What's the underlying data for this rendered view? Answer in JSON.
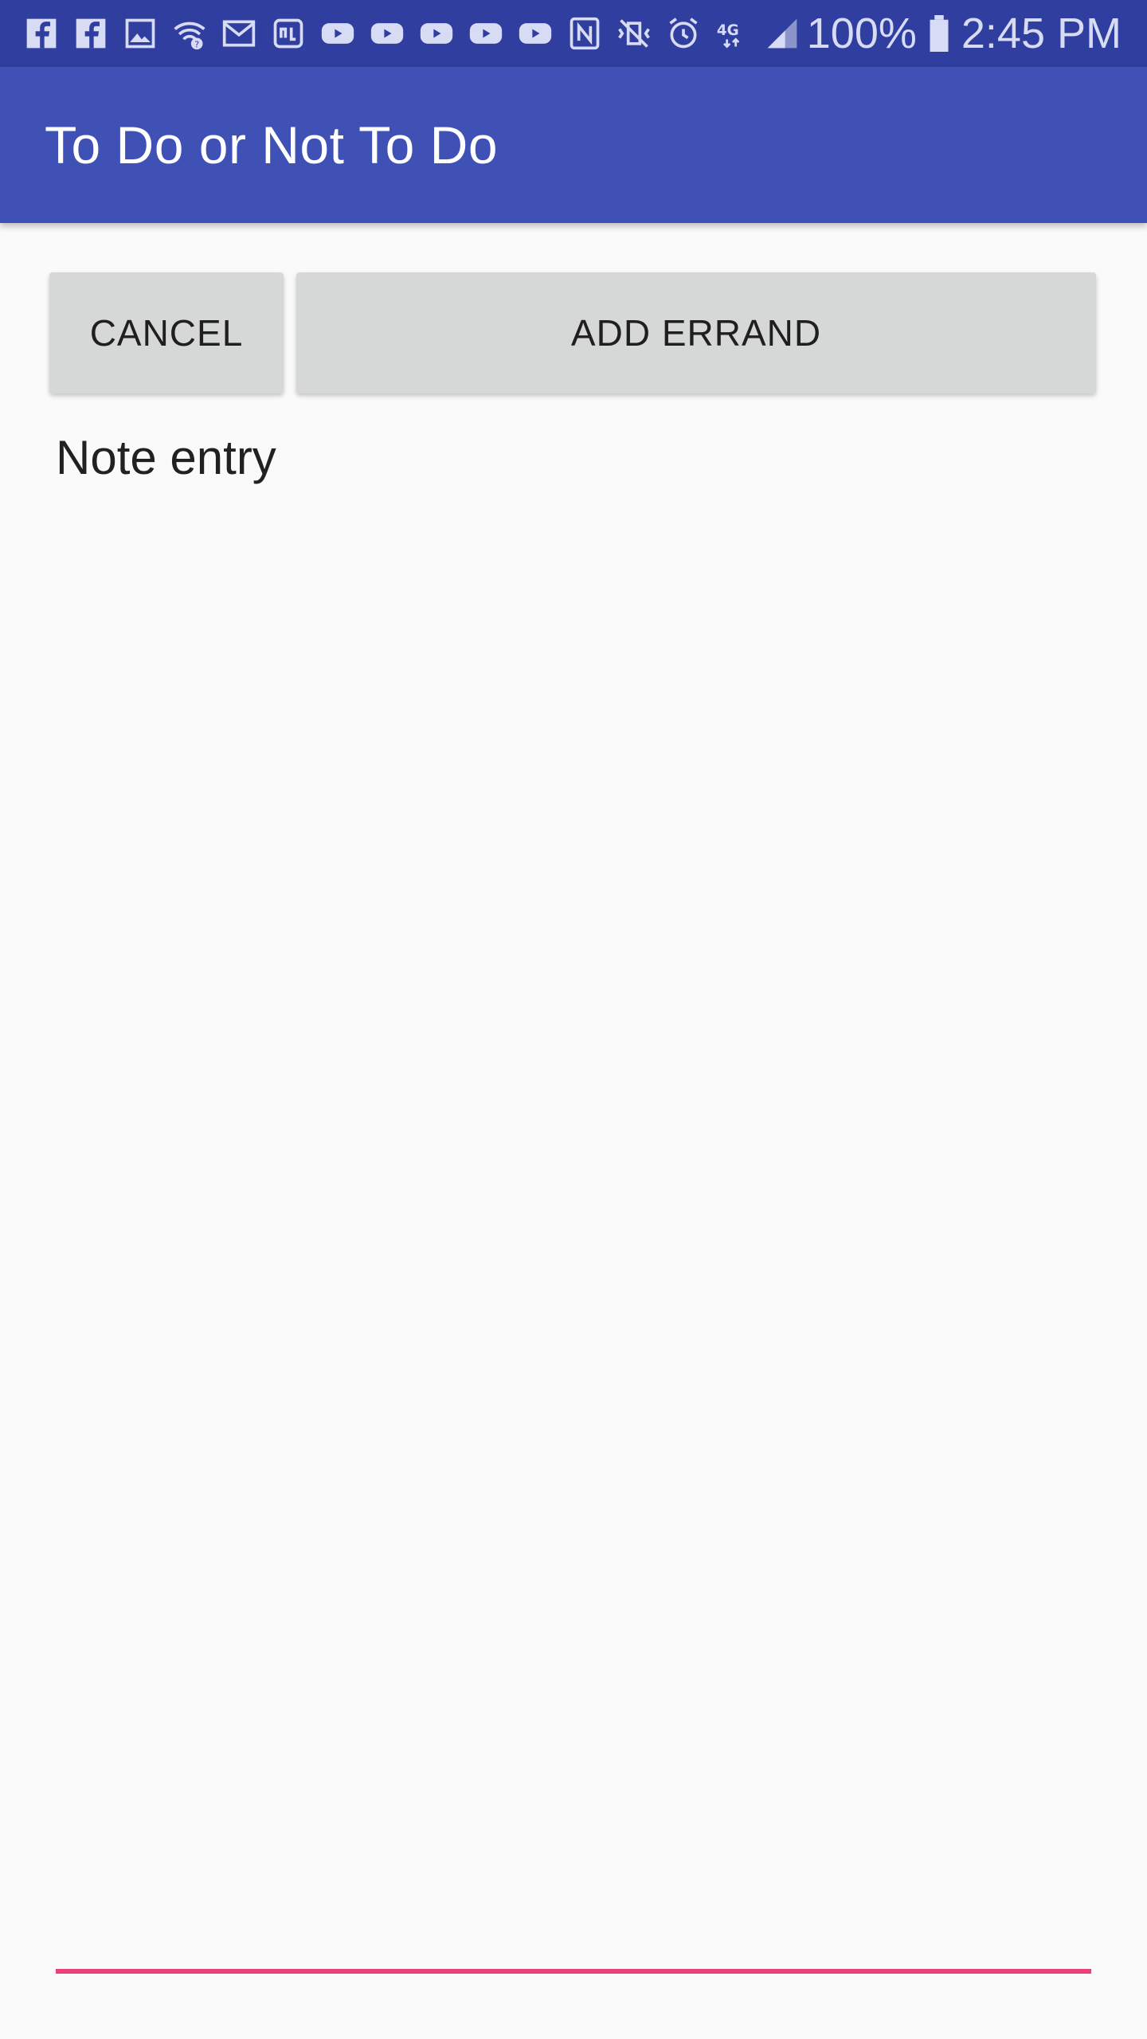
{
  "status_bar": {
    "icons": [
      "facebook-icon",
      "facebook-icon",
      "gallery-icon",
      "wifi-question-icon",
      "gmail-icon",
      "sensor-icon",
      "youtube-icon",
      "youtube-icon",
      "youtube-icon",
      "youtube-icon",
      "youtube-icon",
      "nfc-icon",
      "vibrate-off-icon",
      "alarm-icon",
      "lte-icon",
      "signal-icon"
    ],
    "battery": "100%",
    "time": "2:45 PM"
  },
  "app_bar": {
    "title": "To Do or Not To Do"
  },
  "actions": {
    "cancel_label": "CANCEL",
    "add_label": "ADD ERRAND"
  },
  "note": {
    "placeholder": "Note entry"
  },
  "colors": {
    "status_bar": "#303f9f",
    "app_bar": "#3f51b5",
    "accent": "#ec407a",
    "background": "#fafafa",
    "button": "#d6d7d7"
  }
}
